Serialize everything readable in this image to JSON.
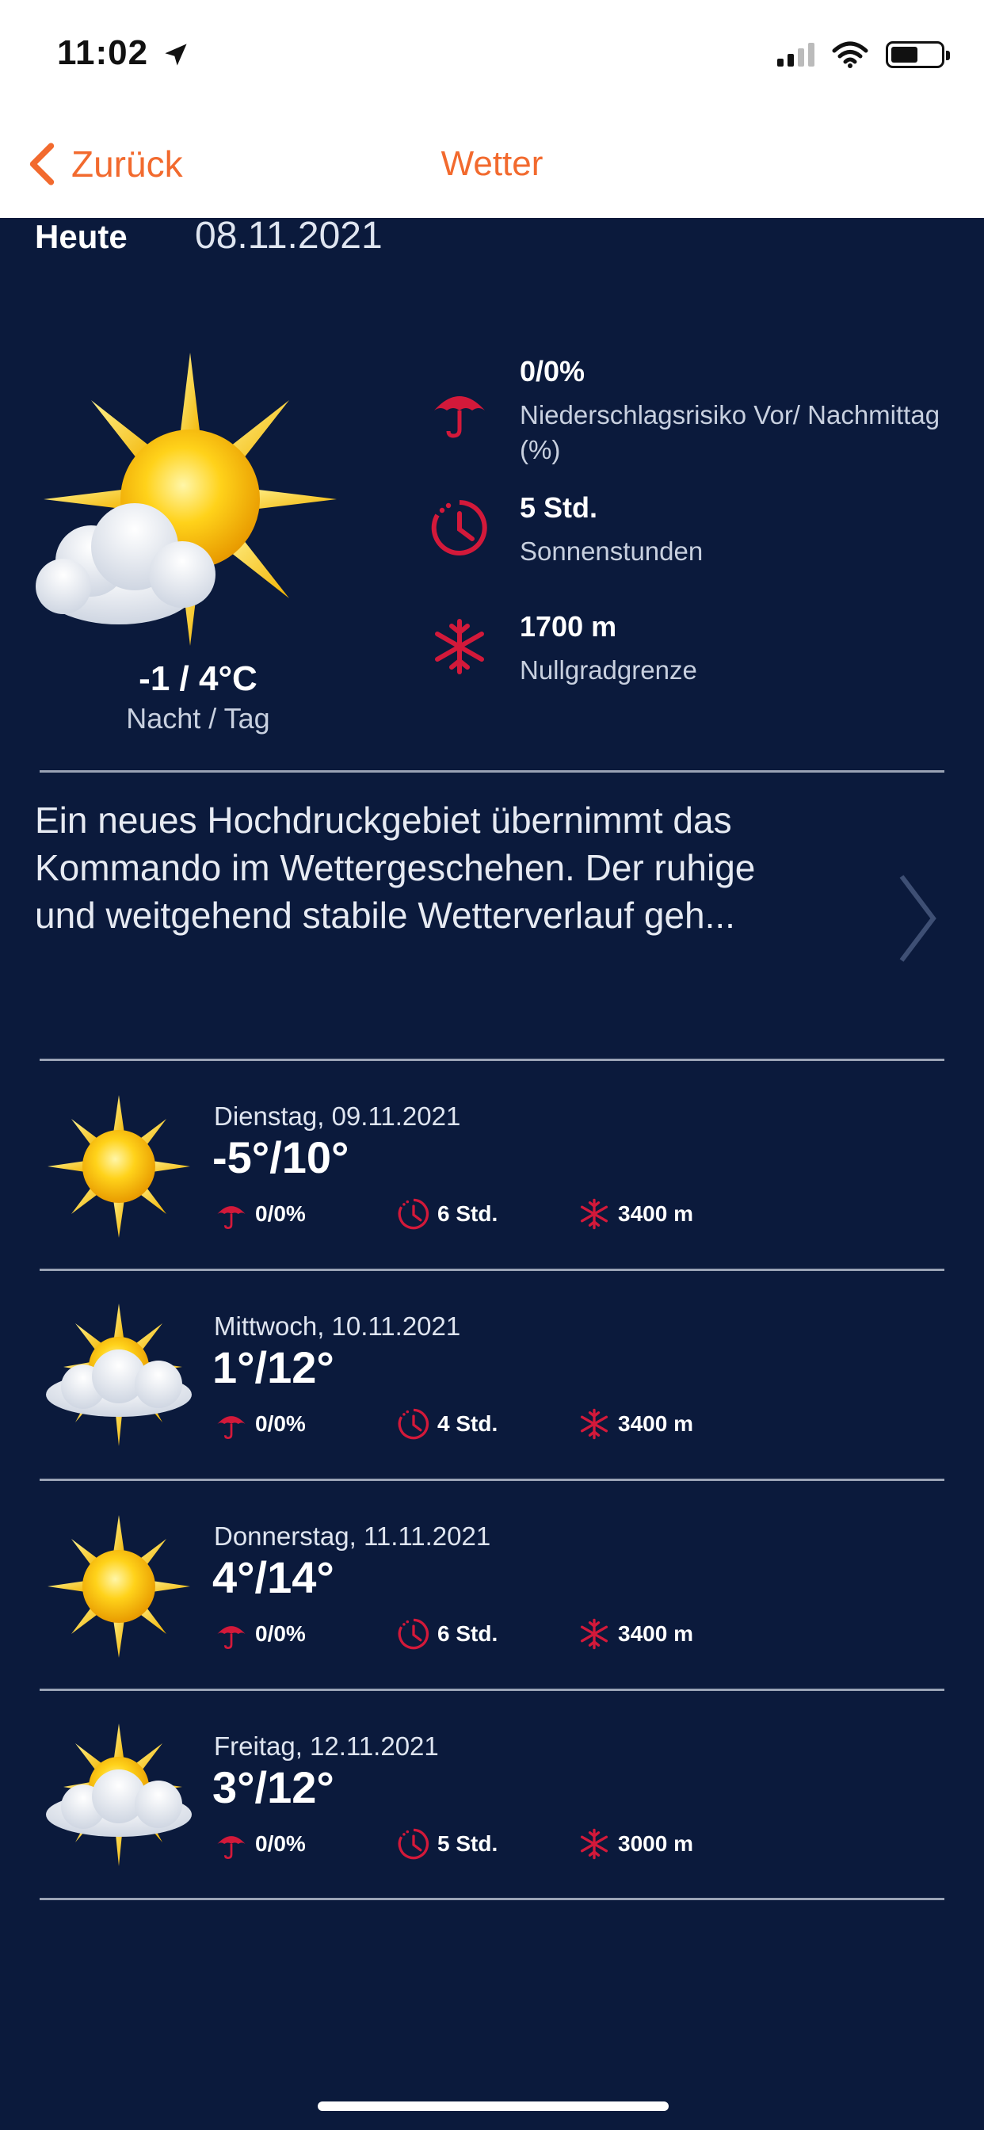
{
  "status_bar": {
    "time": "11:02"
  },
  "nav": {
    "back_label": "Zurück",
    "title": "Wetter"
  },
  "today": {
    "label": "Heute",
    "date": "08.11.2021",
    "temp": "-1 / 4°C",
    "temp_sub": "Nacht / Tag",
    "precip_value": "0/0%",
    "precip_label": "Niederschlagsrisiko Vor/ Nachmittag (%)",
    "sun_value": "5 Std.",
    "sun_label": "Sonnenstunden",
    "zero_value": "1700 m",
    "zero_label": "Nullgradgrenze"
  },
  "description": "Ein neues Hochdruckgebiet übernimmt das Kommando im Wettergeschehen. Der ruhige und weitgehend stabile Wetterverlauf geh...",
  "forecast": [
    {
      "day": "Dienstag, 09.11.2021",
      "temp": "-5°/10°",
      "precip": "0/0%",
      "sun": "6 Std.",
      "zero": "3400 m",
      "icon": "sun-icon"
    },
    {
      "day": "Mittwoch, 10.11.2021",
      "temp": "1°/12°",
      "precip": "0/0%",
      "sun": "4 Std.",
      "zero": "3400 m",
      "icon": "sun-cloud-icon"
    },
    {
      "day": "Donnerstag, 11.11.2021",
      "temp": "4°/14°",
      "precip": "0/0%",
      "sun": "6 Std.",
      "zero": "3400 m",
      "icon": "sun-icon"
    },
    {
      "day": "Freitag, 12.11.2021",
      "temp": "3°/12°",
      "precip": "0/0%",
      "sun": "5 Std.",
      "zero": "3000 m",
      "icon": "sun-cloud-icon"
    }
  ],
  "colors": {
    "accent": "#f26a2e",
    "background": "#0b1a3c",
    "icon_red": "#d3193a"
  }
}
